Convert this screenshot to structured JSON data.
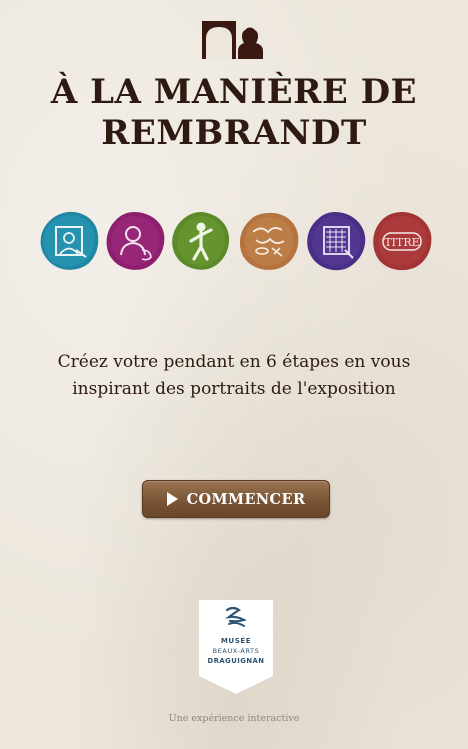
{
  "header": {
    "logo_icon": "portrait-pair-icon",
    "title_line1": "À LA MANIÈRE DE",
    "title_line2": "REMBRANDT"
  },
  "steps": [
    {
      "icon": "frame-portrait-icon",
      "color": "#1f87a3"
    },
    {
      "icon": "bust-portrait-icon",
      "color": "#8c1f6e"
    },
    {
      "icon": "pose-figure-icon",
      "color": "#5c8a2a"
    },
    {
      "icon": "costume-sketch-icon",
      "color": "#b5743f"
    },
    {
      "icon": "background-hatch-icon",
      "color": "#4a2f86"
    },
    {
      "icon": "title-text-icon",
      "color": "#a33436",
      "label": "TITRE"
    }
  ],
  "tagline": {
    "line1": "Créez votre pendant en 6 étapes en vous",
    "line2": "inspirant des portraits de l'exposition"
  },
  "start_button": {
    "icon": "play-icon",
    "label": "COMMENCER"
  },
  "museum_logo": {
    "icon": "museum-emblem-icon",
    "line1": "MUSÉE",
    "line2": "BEAUX-ARTS",
    "line3": "DRAGUIGNAN"
  },
  "footer": {
    "text": "Une expérience interactive"
  },
  "colors": {
    "background": "#ece6dc",
    "title": "#2e1a12",
    "button": "#7a5535",
    "museum_blue": "#2c5372"
  }
}
